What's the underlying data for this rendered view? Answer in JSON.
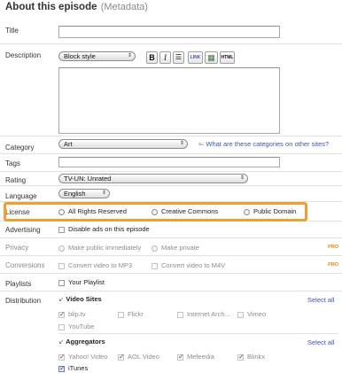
{
  "header": {
    "title": "About this episode",
    "subtitle": "(Metadata)"
  },
  "labels": {
    "title": "Title",
    "description": "Description",
    "category": "Category",
    "tags": "Tags",
    "rating": "Rating",
    "language": "Language",
    "license": "License",
    "advertising": "Advertising",
    "privacy": "Privacy",
    "conversions": "Conversions",
    "playlists": "Playlists",
    "distribution": "Distribution"
  },
  "description": {
    "style_value": "Block style",
    "toolbar": {
      "bold": "B",
      "italic": "I",
      "list": "☰",
      "link": "LINK",
      "image": "▦",
      "html": "HTML"
    }
  },
  "category": {
    "value": "Art",
    "hint": "What are these categories on other sites?"
  },
  "rating": {
    "value": "TV-UN: Unrated"
  },
  "language": {
    "value": "English"
  },
  "license": {
    "options": [
      "All Rights Reserved",
      "Creative Commons",
      "Public Domain"
    ]
  },
  "advertising": {
    "option": "Disable ads on this episode"
  },
  "privacy": {
    "options": [
      "Make public immediately",
      "Make private"
    ],
    "pro": "PRO"
  },
  "conversions": {
    "options": [
      "Convert video to MP3",
      "Convert video to M4V"
    ],
    "pro": "PRO"
  },
  "playlists": {
    "option": "Your Playlist"
  },
  "distribution": {
    "video_sites": {
      "title": "Video Sites",
      "select_all": "Select all",
      "items": [
        "blip.tv",
        "Flickr",
        "Internet Arch...",
        "Vimeo",
        "YouTube"
      ]
    },
    "aggregators": {
      "title": "Aggregators",
      "select_all": "Select all",
      "items": [
        "Yahoo! Video",
        "AOL Video",
        "Mefeedia",
        "Blinkx",
        "iTunes"
      ]
    }
  },
  "colors": {
    "accent": "#f0a030",
    "link": "#3a57b8",
    "pro": "#e08a10"
  }
}
